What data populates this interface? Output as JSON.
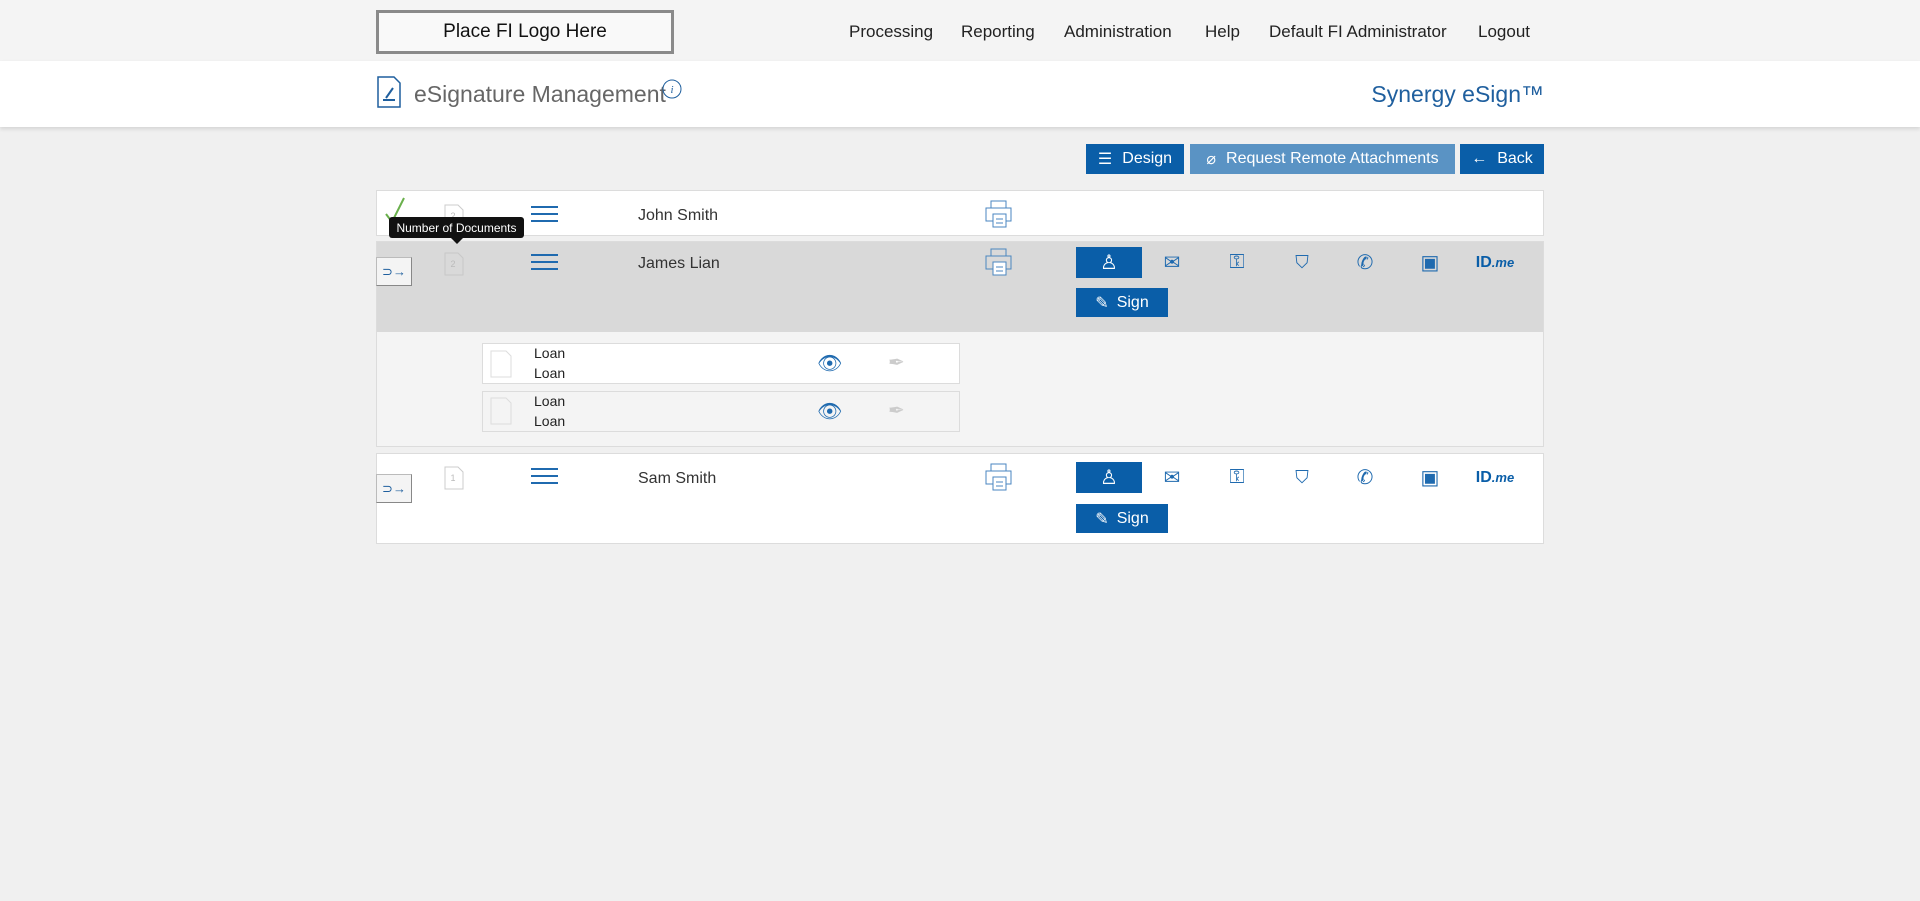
{
  "topbar": {
    "logo": "Place FI Logo Here",
    "nav": [
      "Processing",
      "Reporting",
      "Administration",
      "Help",
      "Default FI Administrator",
      "Logout"
    ]
  },
  "header": {
    "title": "eSignature Management",
    "brand": "Synergy eSign™"
  },
  "toolbar": {
    "design": "Design",
    "request": "Request Remote Attachments",
    "back": "Back"
  },
  "tooltip": "Number of Documents",
  "signers": [
    {
      "name": "John Smith",
      "doc_count": "2",
      "completed": true
    },
    {
      "name": "James Lian",
      "doc_count": "2",
      "sign": "Sign"
    },
    {
      "name": "Sam Smith",
      "doc_count": "1",
      "sign": "Sign"
    }
  ],
  "documents": [
    {
      "line1": "Loan",
      "line2": "Loan"
    },
    {
      "line1": "Loan",
      "line2": "Loan"
    }
  ],
  "auth_methods": [
    "user-icon",
    "cloud-email-icon",
    "cloud-key-icon",
    "cloud-shield-question-icon",
    "cloud-phone-icon",
    "cloud-id-card-icon",
    "idme-logo"
  ],
  "idme": {
    "id": "ID",
    "me": ".me"
  },
  "colors": {
    "primary": "#0a5ea8",
    "secondary": "#5a93c4",
    "row_selected": "#d9d9d9"
  }
}
